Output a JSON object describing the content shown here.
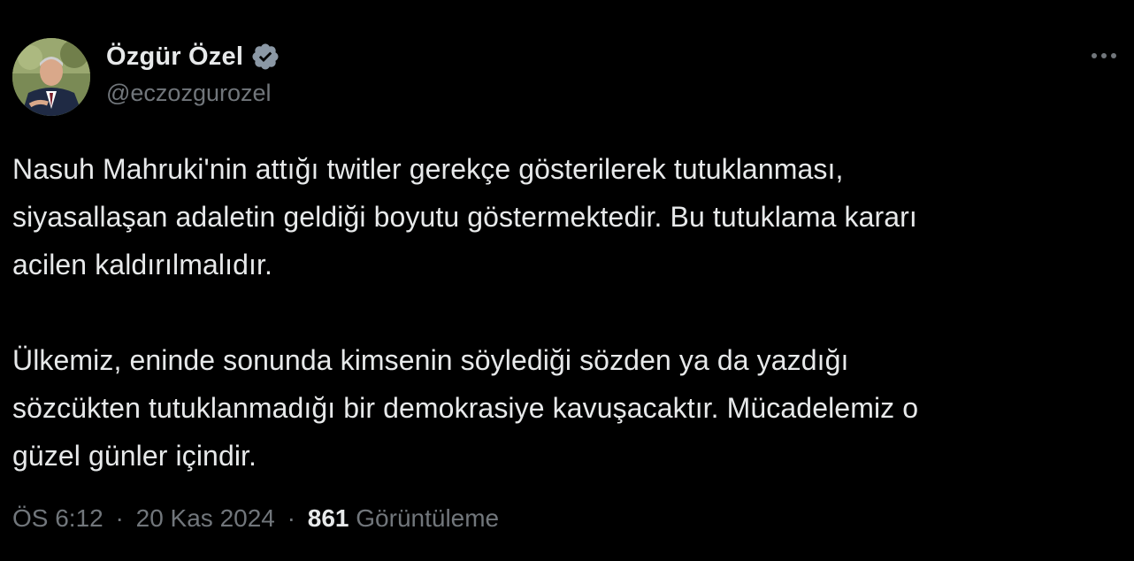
{
  "author": {
    "display_name": "Özgür Özel",
    "handle": "@eczozgurozel",
    "verified": true,
    "verified_color": "#8b98a5",
    "avatar_icon": "profile-photo"
  },
  "actions": {
    "more_icon": "more-horizontal-icon"
  },
  "tweet": {
    "lines": [
      "Nasuh Mahruki'nin attığı twitler gerekçe gösterilerek tutuklanması,",
      "siyasallaşan adaletin geldiği boyutu göstermektedir. Bu tutuklama kararı",
      "acilen kaldırılmalıdır.",
      "Ülkemiz, eninde sonunda kimsenin söylediği sözden ya da yazdığı",
      "sözcükten tutuklanmadığı bir demokrasiye kavuşacaktır. Mücadelemiz o",
      "güzel günler içindir."
    ]
  },
  "meta": {
    "time": "ÖS 6:12",
    "separator": "·",
    "date": "20 Kas 2024",
    "views_count": "861",
    "views_label": "Görüntüleme"
  },
  "colors": {
    "background": "#000000",
    "text": "#e7e9ea",
    "secondary": "#71767b"
  }
}
